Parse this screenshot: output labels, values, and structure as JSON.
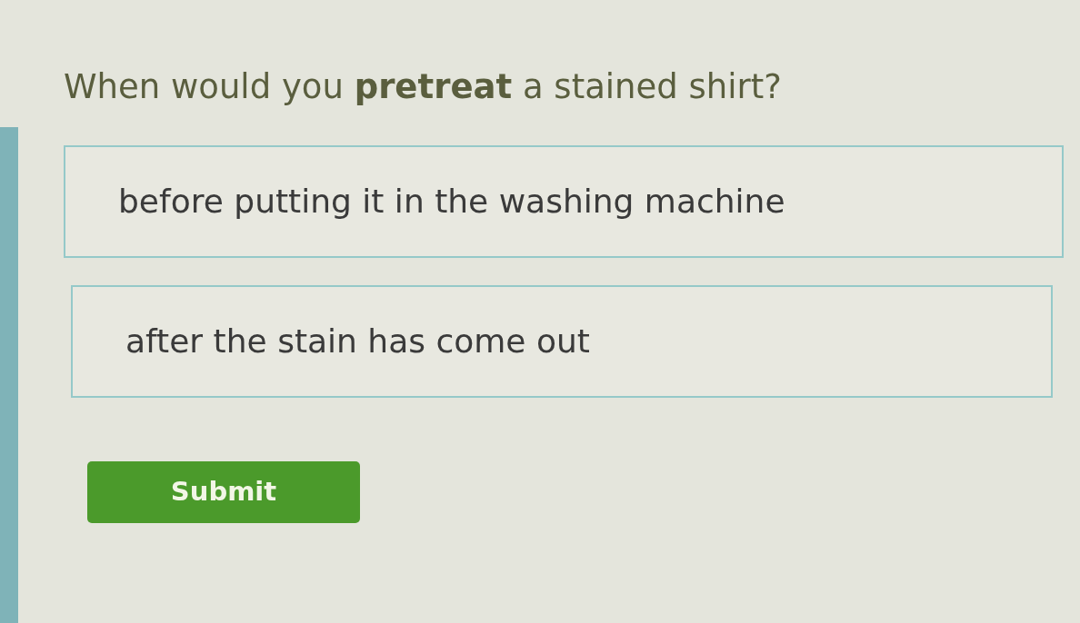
{
  "question": "When would you **pretreat** a stained shirt?",
  "options": [
    {
      "label": "before putting it in the washing machine",
      "selected": false
    },
    {
      "label": "after the stain has come out",
      "selected": false
    }
  ],
  "submit_button": {
    "label": "Submit"
  }
}
